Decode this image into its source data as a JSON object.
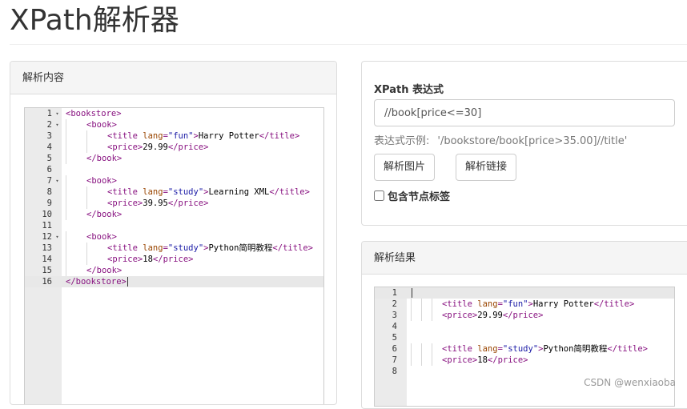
{
  "page": {
    "title": "XPath解析器"
  },
  "source_panel": {
    "heading": "解析内容",
    "lines": [
      {
        "num": "1",
        "fold": "▾",
        "indent": 0,
        "segs": [
          [
            "tag",
            "<bookstore>"
          ]
        ]
      },
      {
        "num": "2",
        "fold": "▾",
        "indent": 1,
        "segs": [
          [
            "tag",
            "<book>"
          ]
        ]
      },
      {
        "num": "3",
        "fold": "",
        "indent": 2,
        "segs": [
          [
            "tag",
            "<title "
          ],
          [
            "attr",
            "lang"
          ],
          [
            "tag",
            "="
          ],
          [
            "val",
            "\"fun\""
          ],
          [
            "tag",
            ">"
          ],
          [
            "txt",
            "Harry Potter"
          ],
          [
            "tag",
            "</title>"
          ]
        ]
      },
      {
        "num": "4",
        "fold": "",
        "indent": 2,
        "segs": [
          [
            "tag",
            "<price>"
          ],
          [
            "txt",
            "29.99"
          ],
          [
            "tag",
            "</price>"
          ]
        ]
      },
      {
        "num": "5",
        "fold": "",
        "indent": 1,
        "segs": [
          [
            "tag",
            "</book>"
          ]
        ]
      },
      {
        "num": "6",
        "fold": "",
        "indent": 0,
        "segs": []
      },
      {
        "num": "7",
        "fold": "▾",
        "indent": 1,
        "segs": [
          [
            "tag",
            "<book>"
          ]
        ]
      },
      {
        "num": "8",
        "fold": "",
        "indent": 2,
        "segs": [
          [
            "tag",
            "<title "
          ],
          [
            "attr",
            "lang"
          ],
          [
            "tag",
            "="
          ],
          [
            "val",
            "\"study\""
          ],
          [
            "tag",
            ">"
          ],
          [
            "txt",
            "Learning XML"
          ],
          [
            "tag",
            "</title>"
          ]
        ]
      },
      {
        "num": "9",
        "fold": "",
        "indent": 2,
        "segs": [
          [
            "tag",
            "<price>"
          ],
          [
            "txt",
            "39.95"
          ],
          [
            "tag",
            "</price>"
          ]
        ]
      },
      {
        "num": "10",
        "fold": "",
        "indent": 1,
        "segs": [
          [
            "tag",
            "</book>"
          ]
        ]
      },
      {
        "num": "11",
        "fold": "",
        "indent": 0,
        "segs": []
      },
      {
        "num": "12",
        "fold": "▾",
        "indent": 1,
        "segs": [
          [
            "tag",
            "<book>"
          ]
        ]
      },
      {
        "num": "13",
        "fold": "",
        "indent": 2,
        "segs": [
          [
            "tag",
            "<title "
          ],
          [
            "attr",
            "lang"
          ],
          [
            "tag",
            "="
          ],
          [
            "val",
            "\"study\""
          ],
          [
            "tag",
            ">"
          ],
          [
            "txt",
            "Python简明教程"
          ],
          [
            "tag",
            "</title>"
          ]
        ]
      },
      {
        "num": "14",
        "fold": "",
        "indent": 2,
        "segs": [
          [
            "tag",
            "<price>"
          ],
          [
            "txt",
            "18"
          ],
          [
            "tag",
            "</price>"
          ]
        ]
      },
      {
        "num": "15",
        "fold": "",
        "indent": 1,
        "segs": [
          [
            "tag",
            "</book>"
          ]
        ]
      },
      {
        "num": "16",
        "fold": "",
        "indent": 0,
        "segs": [
          [
            "tag",
            "</bookstore>"
          ]
        ],
        "active": true,
        "cursor": true
      }
    ]
  },
  "expression_panel": {
    "label": "XPath 表达式",
    "input_value": "//book[price<=30]",
    "help_prefix": "表达式示例:",
    "help_example": "'/bookstore/book[price>35.00]//title'",
    "parse_image_button": "解析图片",
    "parse_link_button": "解析链接",
    "include_tags_label": "包含节点标签",
    "include_tags_checked": false
  },
  "result_panel": {
    "heading": "解析结果",
    "lines": [
      {
        "num": "1",
        "indent": 0,
        "segs": [],
        "active": true,
        "cursor": true
      },
      {
        "num": "2",
        "indent": 3,
        "segs": [
          [
            "tag",
            "<title "
          ],
          [
            "attr",
            "lang"
          ],
          [
            "tag",
            "="
          ],
          [
            "val",
            "\"fun\""
          ],
          [
            "tag",
            ">"
          ],
          [
            "txt",
            "Harry Potter"
          ],
          [
            "tag",
            "</title>"
          ]
        ]
      },
      {
        "num": "3",
        "indent": 3,
        "segs": [
          [
            "tag",
            "<price>"
          ],
          [
            "txt",
            "29.99"
          ],
          [
            "tag",
            "</price>"
          ]
        ]
      },
      {
        "num": "4",
        "indent": 0,
        "segs": []
      },
      {
        "num": "5",
        "indent": 0,
        "segs": []
      },
      {
        "num": "6",
        "indent": 3,
        "segs": [
          [
            "tag",
            "<title "
          ],
          [
            "attr",
            "lang"
          ],
          [
            "tag",
            "="
          ],
          [
            "val",
            "\"study\""
          ],
          [
            "tag",
            ">"
          ],
          [
            "txt",
            "Python简明教程"
          ],
          [
            "tag",
            "</title>"
          ]
        ]
      },
      {
        "num": "7",
        "indent": 3,
        "segs": [
          [
            "tag",
            "<price>"
          ],
          [
            "txt",
            "18"
          ],
          [
            "tag",
            "</price>"
          ]
        ]
      },
      {
        "num": "8",
        "indent": 0,
        "segs": []
      }
    ]
  },
  "watermark": "CSDN @wenxiaoba",
  "icons": {
    "fold_marker": "fold-arrow-icon"
  }
}
